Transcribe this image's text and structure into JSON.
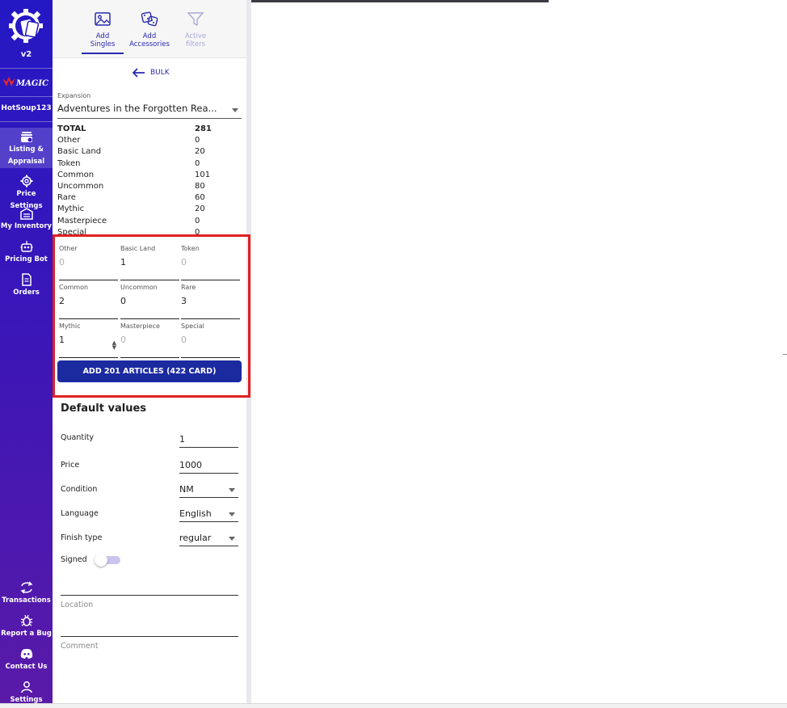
{
  "sidebar": {
    "version": "v2",
    "game_logo": "MAGIC",
    "username": "HotSoup123",
    "items": [
      {
        "label": "Listing & Appraisal",
        "icon": "cards-stack-icon"
      },
      {
        "label": "Price Settings",
        "icon": "gear-icon"
      },
      {
        "label": "My Inventory",
        "icon": "warehouse-icon"
      },
      {
        "label": "Pricing Bot",
        "icon": "robot-icon"
      },
      {
        "label": "Orders",
        "icon": "document-icon"
      }
    ],
    "bottom_items": [
      {
        "label": "Transactions",
        "icon": "swap-arrows-icon"
      },
      {
        "label": "Report a Bug",
        "icon": "bug-icon"
      },
      {
        "label": "Contact Us",
        "icon": "discord-icon"
      },
      {
        "label": "Settings",
        "icon": "user-icon"
      }
    ]
  },
  "tabs": [
    {
      "line1": "Add",
      "line2": "Singles",
      "icon": "image-icon"
    },
    {
      "line1": "Add",
      "line2": "Accessories",
      "icon": "dice-icon"
    },
    {
      "line1": "Active",
      "line2": "filters",
      "icon": "filter-icon"
    }
  ],
  "bulk": {
    "label": "BULK"
  },
  "expansion": {
    "label": "Expansion",
    "value": "Adventures in the Forgotten Rea..."
  },
  "stats": [
    {
      "name": "TOTAL",
      "value": "281"
    },
    {
      "name": "Other",
      "value": "0"
    },
    {
      "name": "Basic Land",
      "value": "20"
    },
    {
      "name": "Token",
      "value": "0"
    },
    {
      "name": "Common",
      "value": "101"
    },
    {
      "name": "Uncommon",
      "value": "80"
    },
    {
      "name": "Rare",
      "value": "60"
    },
    {
      "name": "Mythic",
      "value": "20"
    },
    {
      "name": "Masterpiece",
      "value": "0"
    },
    {
      "name": "Special",
      "value": "0"
    }
  ],
  "qty_fields": [
    {
      "label": "Other",
      "value": "0",
      "placeholder": true
    },
    {
      "label": "Basic Land",
      "value": "1",
      "placeholder": false
    },
    {
      "label": "Token",
      "value": "0",
      "placeholder": true
    },
    {
      "label": "Common",
      "value": "2",
      "placeholder": false
    },
    {
      "label": "Uncommon",
      "value": "0",
      "placeholder": false
    },
    {
      "label": "Rare",
      "value": "3",
      "placeholder": false
    },
    {
      "label": "Mythic",
      "value": "1",
      "placeholder": false
    },
    {
      "label": "Masterpiece",
      "value": "0",
      "placeholder": true
    },
    {
      "label": "Special",
      "value": "0",
      "placeholder": true
    }
  ],
  "add_button": {
    "label": "ADD 201 ARTICLES (422 CARD)"
  },
  "defaults": {
    "title": "Default values",
    "quantity": {
      "label": "Quantity",
      "value": "1"
    },
    "price": {
      "label": "Price",
      "value": "1000"
    },
    "condition": {
      "label": "Condition",
      "value": "NM"
    },
    "language": {
      "label": "Language",
      "value": "English"
    },
    "finish": {
      "label": "Finish type",
      "value": "regular"
    },
    "signed": {
      "label": "Signed",
      "on": false
    },
    "location": {
      "placeholder": "Location"
    },
    "comment": {
      "placeholder": "Comment"
    }
  },
  "colors": {
    "accent": "#1c2aa0",
    "highlight_box": "#e02020",
    "sidebar_top": "#2418c4",
    "sidebar_bottom": "#5a1aa8"
  }
}
